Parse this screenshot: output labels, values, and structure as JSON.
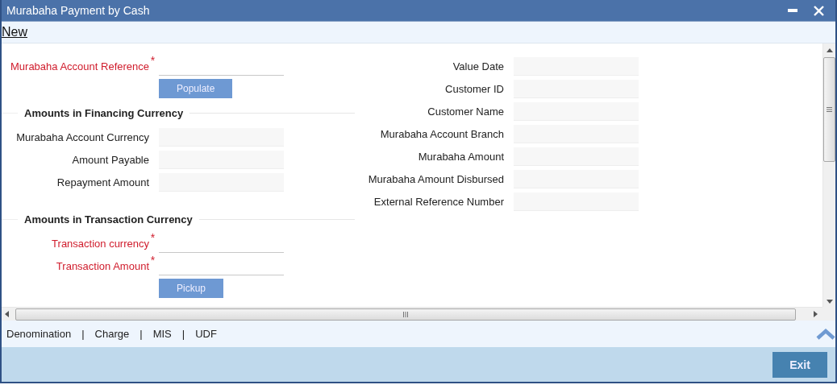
{
  "window": {
    "title": "Murabaha Payment by Cash"
  },
  "toolbar": {
    "action": "New"
  },
  "left_column": [
    {
      "kind": "field",
      "label": "Murabaha Account Reference",
      "required": true,
      "mark": "*",
      "disabled": false
    },
    {
      "kind": "button",
      "label": "Populate"
    },
    {
      "kind": "heading",
      "label": "Amounts in Financing Currency"
    },
    {
      "kind": "field",
      "label": "Murabaha Account Currency",
      "required": false,
      "disabled": true
    },
    {
      "kind": "field",
      "label": "Amount Payable",
      "required": false,
      "disabled": true
    },
    {
      "kind": "field",
      "label": "Repayment Amount",
      "required": false,
      "disabled": true
    },
    {
      "kind": "heading",
      "label": "Amounts in Transaction Currency"
    },
    {
      "kind": "field",
      "label": "Transaction currency",
      "required": true,
      "mark": "*",
      "disabled": false
    },
    {
      "kind": "field",
      "label": "Transaction Amount",
      "required": true,
      "mark": "*",
      "disabled": false
    },
    {
      "kind": "button",
      "label": "Pickup"
    }
  ],
  "right_column": [
    {
      "kind": "field",
      "label": "Value Date",
      "required": false,
      "disabled": true
    },
    {
      "kind": "field",
      "label": "Customer ID",
      "required": false,
      "disabled": true
    },
    {
      "kind": "field",
      "label": "Customer Name",
      "required": false,
      "disabled": true
    },
    {
      "kind": "field",
      "label": "Murabaha Account Branch",
      "required": false,
      "disabled": true
    },
    {
      "kind": "field",
      "label": "Murabaha Amount",
      "required": false,
      "disabled": true
    },
    {
      "kind": "field",
      "label": "Murabaha Amount Disbursed",
      "required": false,
      "disabled": true
    },
    {
      "kind": "field",
      "label": "External Reference Number",
      "required": false,
      "disabled": true
    }
  ],
  "tab_links": {
    "separator": "|",
    "items": [
      "Denomination",
      "Charge",
      "MIS",
      "UDF"
    ]
  },
  "footer": {
    "buttons": [
      "Exit"
    ]
  }
}
